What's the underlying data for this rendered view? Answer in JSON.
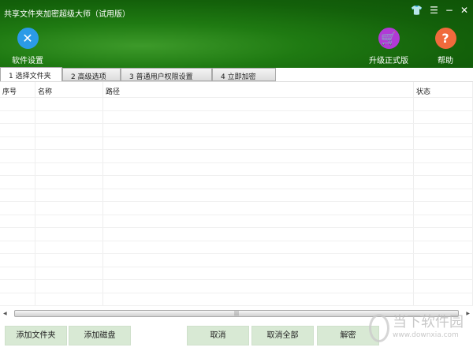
{
  "window": {
    "title": "共享文件夹加密超级大师（试用版）"
  },
  "toolbar": {
    "settings": "软件设置",
    "upgrade": "升级正式版",
    "help": "帮助"
  },
  "tabs": [
    "1 选择文件夹",
    "2 高级选项",
    "3 普通用户权限设置",
    "4 立即加密"
  ],
  "table": {
    "columns": [
      "序号",
      "名称",
      "路径",
      "状态"
    ]
  },
  "buttons": {
    "add_folder": "添加文件夹",
    "add_disk": "添加磁盘",
    "cancel": "取消",
    "cancel_all": "取消全部",
    "decrypt": "解密"
  },
  "watermark": {
    "name": "当下软件园",
    "url": "www.downxia.com"
  }
}
